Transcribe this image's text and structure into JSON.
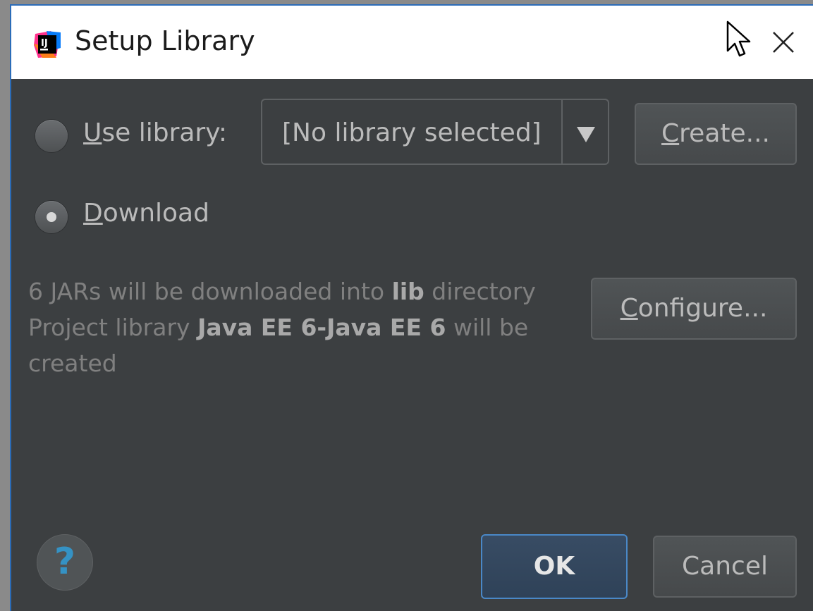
{
  "window": {
    "title": "Setup Library",
    "app_icon": "intellij-idea-icon",
    "close_icon": "close-icon"
  },
  "options": {
    "use_library": {
      "label_underlined": "U",
      "label_rest": "se library:",
      "selected": false
    },
    "download": {
      "label_underlined": "D",
      "label_rest": "ownload",
      "selected": true
    }
  },
  "library_combo": {
    "value": "[No library selected]"
  },
  "buttons": {
    "create": {
      "underlined": "C",
      "rest": "reate..."
    },
    "configure": {
      "underlined": "C",
      "rest": "onfigure..."
    },
    "ok": "OK",
    "cancel": "Cancel",
    "help": "?"
  },
  "description": {
    "line1_pre": "6 JARs will be downloaded into ",
    "line1_bold": "lib",
    "line1_post": " directory",
    "line2_pre": "Project library ",
    "line2_bold": "Java EE 6-Java EE 6",
    "line2_post": " will be",
    "line3": "created"
  },
  "colors": {
    "panel_bg": "#3c3f41",
    "accent": "#4a88c7",
    "help_icon": "#3592c4"
  }
}
